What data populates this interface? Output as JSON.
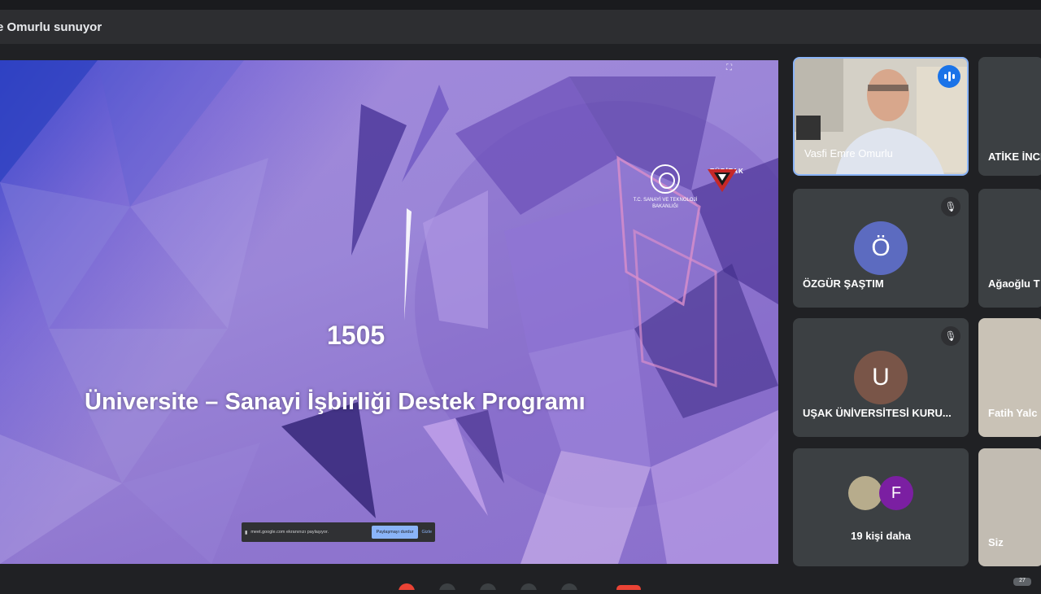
{
  "header": {
    "presenter_text": "e Omurlu sunuyor"
  },
  "slide": {
    "number": "1505",
    "title": "Üniversite – Sanayi İşbirliği Destek Programı",
    "logo_ministry": "T.C. SANAYİ VE TEKNOLOJİ BAKANLIĞI",
    "logo_tubitak": "TÜBİTAK",
    "sharebar_text": "meet.google.com ekranınızı paylaşıyor.",
    "sharebar_stop": "Paylaşmayı durdur",
    "sharebar_hide": "Gizle"
  },
  "participants": [
    {
      "name": "Vasfi Emre Omurlu",
      "type": "video",
      "speaking": true
    },
    {
      "name": "ATİKE İNCE",
      "type": "partial"
    },
    {
      "name": "ÖZGÜR ŞAŞTIM",
      "initial": "Ö",
      "avatar_color": "#5c6bc0",
      "muted": true
    },
    {
      "name": "Ağaoğlu T",
      "type": "partial"
    },
    {
      "name": "UŞAK ÜNİVERSİTESİ KURU...",
      "initial": "U",
      "avatar_color": "#795548",
      "muted": true
    },
    {
      "name": "Fatih Yalc",
      "type": "partial"
    },
    {
      "name": "19 kişi daha",
      "initial": "F",
      "avatar_color": "#7b1fa2"
    },
    {
      "name": "Siz",
      "type": "partial"
    }
  ],
  "footer": {
    "badge": "27"
  },
  "colors": {
    "accent": "#8ab4f8",
    "speaking": "#1a73e8"
  }
}
